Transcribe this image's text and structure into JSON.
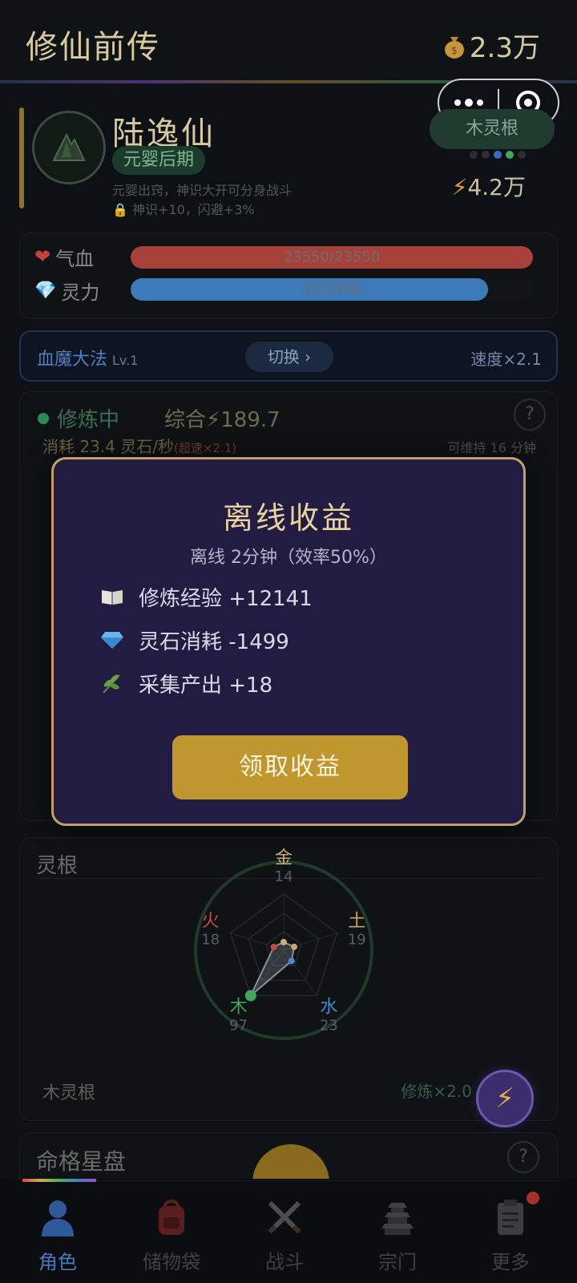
{
  "header": {
    "title": "修仙前传",
    "currency": "2.3万"
  },
  "character": {
    "name": "陆逸仙",
    "realm": "元婴后期",
    "realm_desc": "元婴出窍，神识大开可分身战斗",
    "realm_bonus": "神识+10，闪避+3%",
    "spirit_root": "木灵根",
    "power": "4.2万"
  },
  "stats": {
    "hp_label": "气血",
    "hp_value": "23550/23550",
    "hp_fraction": 1.0,
    "mp_label": "灵力",
    "mp_value": "435/490",
    "mp_fraction": 0.888
  },
  "skill": {
    "name": "血魔大法",
    "level": "Lv.1",
    "switch_label": "切换 ›",
    "speed": "速度×2.1"
  },
  "cultivation": {
    "status": "修炼中",
    "combined": "综合⚡189.7",
    "consume": "消耗 23.4 灵石/秒",
    "boost": "(超速×2.1)",
    "maintain": "可维持 16 分钟",
    "help": "?"
  },
  "roots": {
    "title": "灵根",
    "elements": [
      {
        "name": "金",
        "value": "14",
        "color": "#c9b07a"
      },
      {
        "name": "土",
        "value": "19",
        "color": "#c9a65a"
      },
      {
        "name": "水",
        "value": "23",
        "color": "#4a8ad0"
      },
      {
        "name": "木",
        "value": "97",
        "color": "#3fa85a"
      },
      {
        "name": "火",
        "value": "18",
        "color": "#c84a3a"
      }
    ],
    "root_name": "木灵根",
    "multiplier": "修炼×2.0"
  },
  "star_chart": {
    "title": "命格星盘",
    "help": "?"
  },
  "nav": [
    {
      "label": "角色",
      "icon": "person-icon",
      "active": true
    },
    {
      "label": "储物袋",
      "icon": "backpack-icon",
      "active": false
    },
    {
      "label": "战斗",
      "icon": "crossed-swords-icon",
      "active": false
    },
    {
      "label": "宗门",
      "icon": "pagoda-icon",
      "active": false
    },
    {
      "label": "更多",
      "icon": "clipboard-icon",
      "active": false
    }
  ],
  "modal": {
    "title": "离线收益",
    "subtitle": "离线 2分钟（效率50%）",
    "rewards": [
      {
        "icon": "book-icon",
        "text": "修炼经验 +12141"
      },
      {
        "icon": "gem-icon",
        "text": "灵石消耗 -1499"
      },
      {
        "icon": "herb-icon",
        "text": "采集产出 +18"
      }
    ],
    "claim_label": "领取收益"
  },
  "colors": {
    "accent_gold": "#c0962e",
    "modal_bg": "#221c42",
    "hp": "#a8413a",
    "mp": "#3d7ab8"
  }
}
